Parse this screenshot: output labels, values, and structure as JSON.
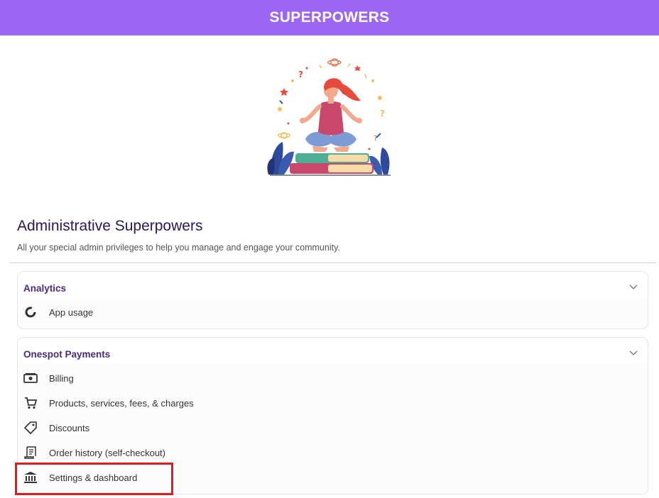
{
  "header": {
    "title": "SUPERPOWERS"
  },
  "page": {
    "heading": "Administrative Superpowers",
    "subheading": "All your special admin privileges to help you manage and engage your community."
  },
  "sections": [
    {
      "title": "Analytics",
      "items": [
        {
          "label": "App usage",
          "icon": "donut-chart-icon"
        }
      ]
    },
    {
      "title": "Onespot Payments",
      "items": [
        {
          "label": "Billing",
          "icon": "cash-icon"
        },
        {
          "label": "Products, services, fees, & charges",
          "icon": "cart-icon"
        },
        {
          "label": "Discounts",
          "icon": "tag-icon"
        },
        {
          "label": "Order history (self-checkout)",
          "icon": "receipt-icon"
        },
        {
          "label": "Settings & dashboard",
          "icon": "bank-icon"
        }
      ]
    }
  ],
  "colors": {
    "header_bg": "#9a66f2",
    "section_title": "#4b2a7a",
    "heading": "#2a1759",
    "highlight": "#e11b1b"
  }
}
